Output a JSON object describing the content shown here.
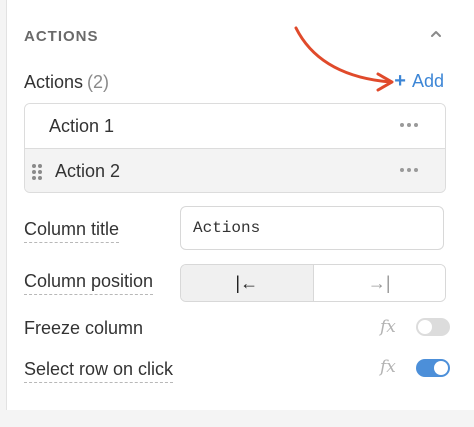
{
  "section": {
    "title": "ACTIONS"
  },
  "actions": {
    "title": "Actions",
    "count": "(2)",
    "add_label": "Add",
    "items": [
      {
        "label": "Action 1"
      },
      {
        "label": "Action 2"
      }
    ]
  },
  "column_title": {
    "label": "Column title",
    "value": "Actions"
  },
  "column_position": {
    "label": "Column position",
    "options": [
      "|←",
      "→|"
    ],
    "selected": 0
  },
  "freeze_column": {
    "label": "Freeze column",
    "enabled": false
  },
  "select_row": {
    "label": "Select row on click",
    "enabled": true
  },
  "colors": {
    "accent": "#3d86d6",
    "annotation_arrow": "#e04a2b",
    "toggle_on": "#4c8fd9"
  },
  "icons": [
    "chevron-up-icon",
    "plus-icon",
    "drag-handle-icon",
    "more-icon",
    "fx-icon"
  ]
}
